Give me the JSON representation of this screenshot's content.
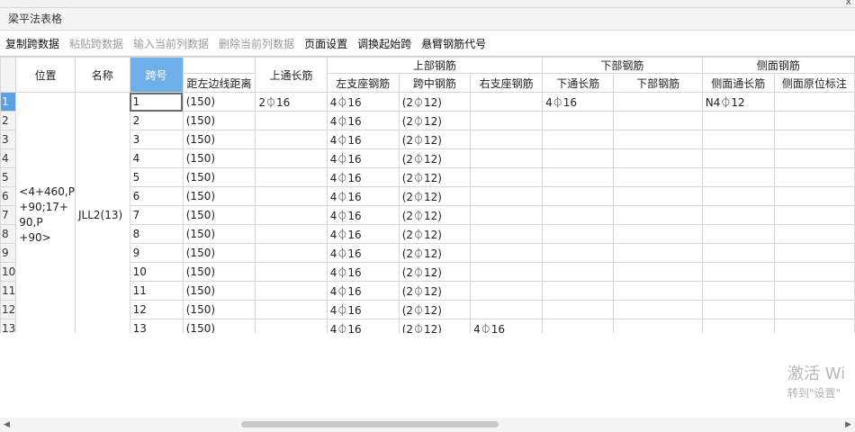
{
  "window": {
    "close_glyph": "x"
  },
  "title": "梁平法表格",
  "toolbar": [
    {
      "label": "复制跨数据",
      "enabled": true
    },
    {
      "label": "粘贴跨数据",
      "enabled": false
    },
    {
      "label": "输入当前列数据",
      "enabled": false
    },
    {
      "label": "删除当前列数据",
      "enabled": false
    },
    {
      "label": "页面设置",
      "enabled": true
    },
    {
      "label": "调换起始跨",
      "enabled": true
    },
    {
      "label": "悬臂钢筋代号",
      "enabled": true
    }
  ],
  "headers": {
    "position": "位置",
    "name": "名称",
    "span": "跨号",
    "edge_distance": "距左边线距离",
    "top_through": "上通长筋",
    "top_group": "上部钢筋",
    "left_support": "左支座钢筋",
    "mid_span": "跨中钢筋",
    "right_support": "右支座钢筋",
    "bottom_group": "下部钢筋",
    "bottom_through": "下通长筋",
    "bottom_bar": "下部钢筋",
    "side_group": "侧面钢筋",
    "side_through": "侧面通长筋",
    "side_local": "侧面原位标注"
  },
  "merged": {
    "position": "<4+460,P +90;17+ 90,P +90>",
    "name": "JLL2(13)"
  },
  "rows": [
    {
      "no": "1",
      "span": "1",
      "edge": "(150)",
      "top_through": "2⏀16",
      "left": "4⏀16",
      "mid": "(2⏀12)",
      "right": "",
      "bottom_through": "4⏀16",
      "bottom": "",
      "side_through": "N4⏀12",
      "side_local": ""
    },
    {
      "no": "2",
      "span": "2",
      "edge": "(150)",
      "top_through": "",
      "left": "4⏀16",
      "mid": "(2⏀12)",
      "right": "",
      "bottom_through": "",
      "bottom": "",
      "side_through": "",
      "side_local": ""
    },
    {
      "no": "3",
      "span": "3",
      "edge": "(150)",
      "top_through": "",
      "left": "4⏀16",
      "mid": "(2⏀12)",
      "right": "",
      "bottom_through": "",
      "bottom": "",
      "side_through": "",
      "side_local": ""
    },
    {
      "no": "4",
      "span": "4",
      "edge": "(150)",
      "top_through": "",
      "left": "4⏀16",
      "mid": "(2⏀12)",
      "right": "",
      "bottom_through": "",
      "bottom": "",
      "side_through": "",
      "side_local": ""
    },
    {
      "no": "5",
      "span": "5",
      "edge": "(150)",
      "top_through": "",
      "left": "4⏀16",
      "mid": "(2⏀12)",
      "right": "",
      "bottom_through": "",
      "bottom": "",
      "side_through": "",
      "side_local": ""
    },
    {
      "no": "6",
      "span": "6",
      "edge": "(150)",
      "top_through": "",
      "left": "4⏀16",
      "mid": "(2⏀12)",
      "right": "",
      "bottom_through": "",
      "bottom": "",
      "side_through": "",
      "side_local": ""
    },
    {
      "no": "7",
      "span": "7",
      "edge": "(150)",
      "top_through": "",
      "left": "4⏀16",
      "mid": "(2⏀12)",
      "right": "",
      "bottom_through": "",
      "bottom": "",
      "side_through": "",
      "side_local": ""
    },
    {
      "no": "8",
      "span": "8",
      "edge": "(150)",
      "top_through": "",
      "left": "4⏀16",
      "mid": "(2⏀12)",
      "right": "",
      "bottom_through": "",
      "bottom": "",
      "side_through": "",
      "side_local": ""
    },
    {
      "no": "9",
      "span": "9",
      "edge": "(150)",
      "top_through": "",
      "left": "4⏀16",
      "mid": "(2⏀12)",
      "right": "",
      "bottom_through": "",
      "bottom": "",
      "side_through": "",
      "side_local": ""
    },
    {
      "no": "10",
      "span": "10",
      "edge": "(150)",
      "top_through": "",
      "left": "4⏀16",
      "mid": "(2⏀12)",
      "right": "",
      "bottom_through": "",
      "bottom": "",
      "side_through": "",
      "side_local": ""
    },
    {
      "no": "11",
      "span": "11",
      "edge": "(150)",
      "top_through": "",
      "left": "4⏀16",
      "mid": "(2⏀12)",
      "right": "",
      "bottom_through": "",
      "bottom": "",
      "side_through": "",
      "side_local": ""
    },
    {
      "no": "12",
      "span": "12",
      "edge": "(150)",
      "top_through": "",
      "left": "4⏀16",
      "mid": "(2⏀12)",
      "right": "",
      "bottom_through": "",
      "bottom": "",
      "side_through": "",
      "side_local": ""
    },
    {
      "no": "13",
      "span": "13",
      "edge": "(150)",
      "top_through": "",
      "left": "4⏀16",
      "mid": "(2⏀12)",
      "right": "4⏀16",
      "bottom_through": "",
      "bottom": "",
      "side_through": "",
      "side_local": ""
    }
  ],
  "watermark": {
    "line1": "激活 Wi",
    "line2": "转到\"设置\""
  },
  "colors": {
    "header_highlight": "#6fb0ea",
    "row_active": "#5aa0e6"
  }
}
